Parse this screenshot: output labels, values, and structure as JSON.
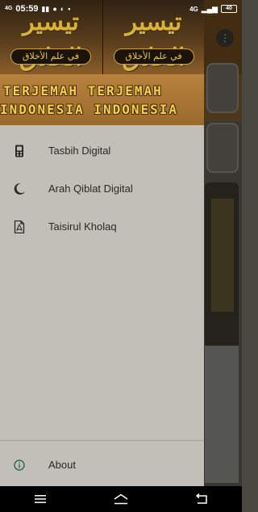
{
  "status_bar": {
    "signal_left": "4G",
    "time": "05:59",
    "right_indicator": "4G",
    "battery": "40"
  },
  "drawer": {
    "header": {
      "arabic_title": "تيسير الخلاق",
      "arabic_subtitle": "في علم الأخلاق",
      "banner_line1": "TERJEMAH TERJEMAH",
      "banner_line2": "INDONESIA INDONESIA"
    },
    "menu_items": [
      {
        "label": "Tasbih Digital",
        "icon": "phone-counter-icon"
      },
      {
        "label": "Arah Qiblat Digital",
        "icon": "crescent-moon-icon"
      },
      {
        "label": "Taisirul Kholaq",
        "icon": "pdf-file-icon"
      }
    ],
    "footer_item": {
      "label": "About",
      "icon": "info-icon"
    }
  },
  "colors": {
    "drawer_bg": "#c2bfb9",
    "icon_dark": "#2b2926",
    "info_icon": "#2e6b4a",
    "banner_text": "#f0d34a",
    "arabic_gold": "#d9b23a"
  }
}
